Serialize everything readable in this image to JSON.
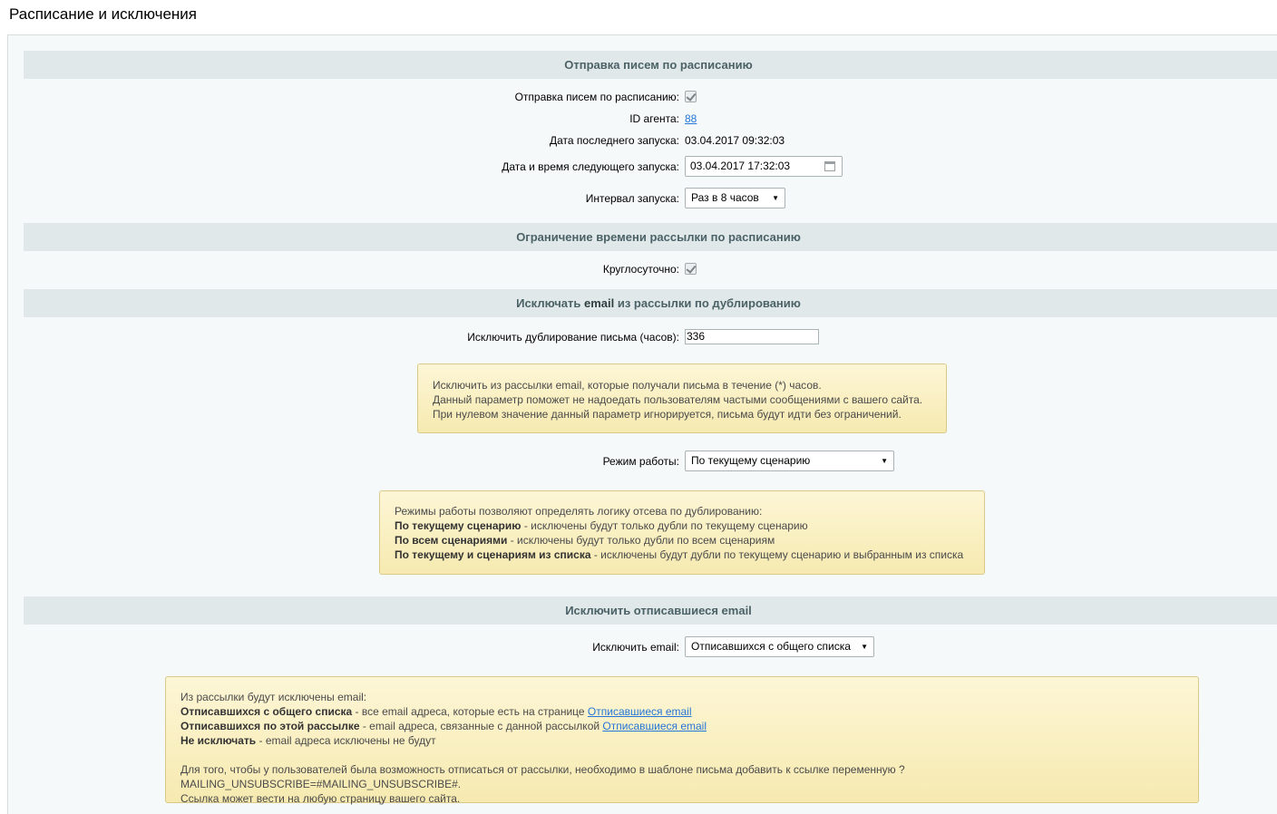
{
  "page": {
    "title": "Расписание и исключения"
  },
  "section1": {
    "title": "Отправка писем по расписанию",
    "schedule_label": "Отправка писем по расписанию:",
    "agent_label": "ID агента:",
    "agent_id": "88",
    "last_run_label": "Дата последнего запуска:",
    "last_run_value": "03.04.2017 09:32:03",
    "next_run_label": "Дата и время следующего запуска:",
    "next_run_value": "03.04.2017 17:32:03",
    "interval_label": "Интервал запуска:",
    "interval_value": "Раз в 8 часов"
  },
  "section2": {
    "title": "Ограничение времени рассылки по расписанию",
    "around_clock_label": "Круглосуточно:"
  },
  "section3": {
    "title_pre": "Исключать ",
    "title_bold": "email",
    "title_post": " из рассылки по дублированию",
    "dup_label": "Исключить дублирование письма (часов):",
    "dup_value": "336",
    "note1": {
      "line1": "Исключить из рассылки email, которые получали письма в течение (*) часов.",
      "line2": "Данный параметр поможет не надоедать пользователям частыми сообщениями с вашего сайта.",
      "line3": "При нулевом значение данный параметр игнорируется, письма будут идти без ограничений."
    },
    "mode_label": "Режим работы:",
    "mode_value": "По текущему сценарию",
    "note2": {
      "intro": "Режимы работы позволяют определять логику отсева по дублированию:",
      "item1_bold": "По текущему сценарию",
      "item1_text": " - исключены будут только дубли по текущему сценарию",
      "item2_bold": "По всем сценариями",
      "item2_text": " - исключены будут только дубли по всем сценариям",
      "item3_bold": "По текущему и сценариям из списка",
      "item3_text": " - исключены будут дубли по текущему сценарию и выбранным из списка"
    }
  },
  "section4": {
    "title": "Исключить отписавшиеся email",
    "exclude_label": "Исключить email:",
    "exclude_value": "Отписавшихся с общего списка",
    "note3": {
      "intro": "Из рассылки будут исключены email:",
      "item1_bold": "Отписавшихся с общего списка",
      "item1_text": " - все email адреса, которые есть на странице ",
      "item1_link": "Отписавшиеся email",
      "item2_bold": "Отписавшихся по этой рассылке",
      "item2_text": " - email адреса, связанные с данной рассылкой ",
      "item2_link": "Отписавшиеся email",
      "item3_bold": "Не исключать",
      "item3_text": " - email адреса исключены не будут",
      "footer1": "Для того, чтобы у пользователей была возможность отписаться от рассылки, необходимо в шаблоне письма добавить к ссылке переменную ?MAILING_UNSUBSCRIBE=#MAILING_UNSUBSCRIBE#.",
      "footer2": "Ссылка может вести на любую страницу вашего сайта."
    }
  }
}
